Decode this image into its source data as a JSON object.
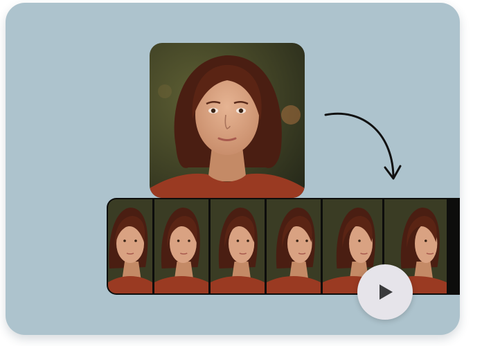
{
  "colors": {
    "card_background": "#adc3cd",
    "filmstrip_border": "#0d0d0c",
    "play_button": "#e6e4ea",
    "play_icon": "#3a3a3c",
    "sweater": "#9a3a22",
    "hair": "#4a1e12"
  },
  "portrait": {
    "icon": "portrait-image",
    "subject": "woman-front-view"
  },
  "filmstrip": {
    "frame_count": 6,
    "frames": [
      {
        "view": "front"
      },
      {
        "view": "front-slight-turn"
      },
      {
        "view": "three-quarter"
      },
      {
        "view": "three-quarter-profile"
      },
      {
        "view": "near-profile"
      },
      {
        "view": "profile"
      }
    ]
  },
  "icons": {
    "arrow": "curved-arrow-icon",
    "play": "play-icon"
  }
}
